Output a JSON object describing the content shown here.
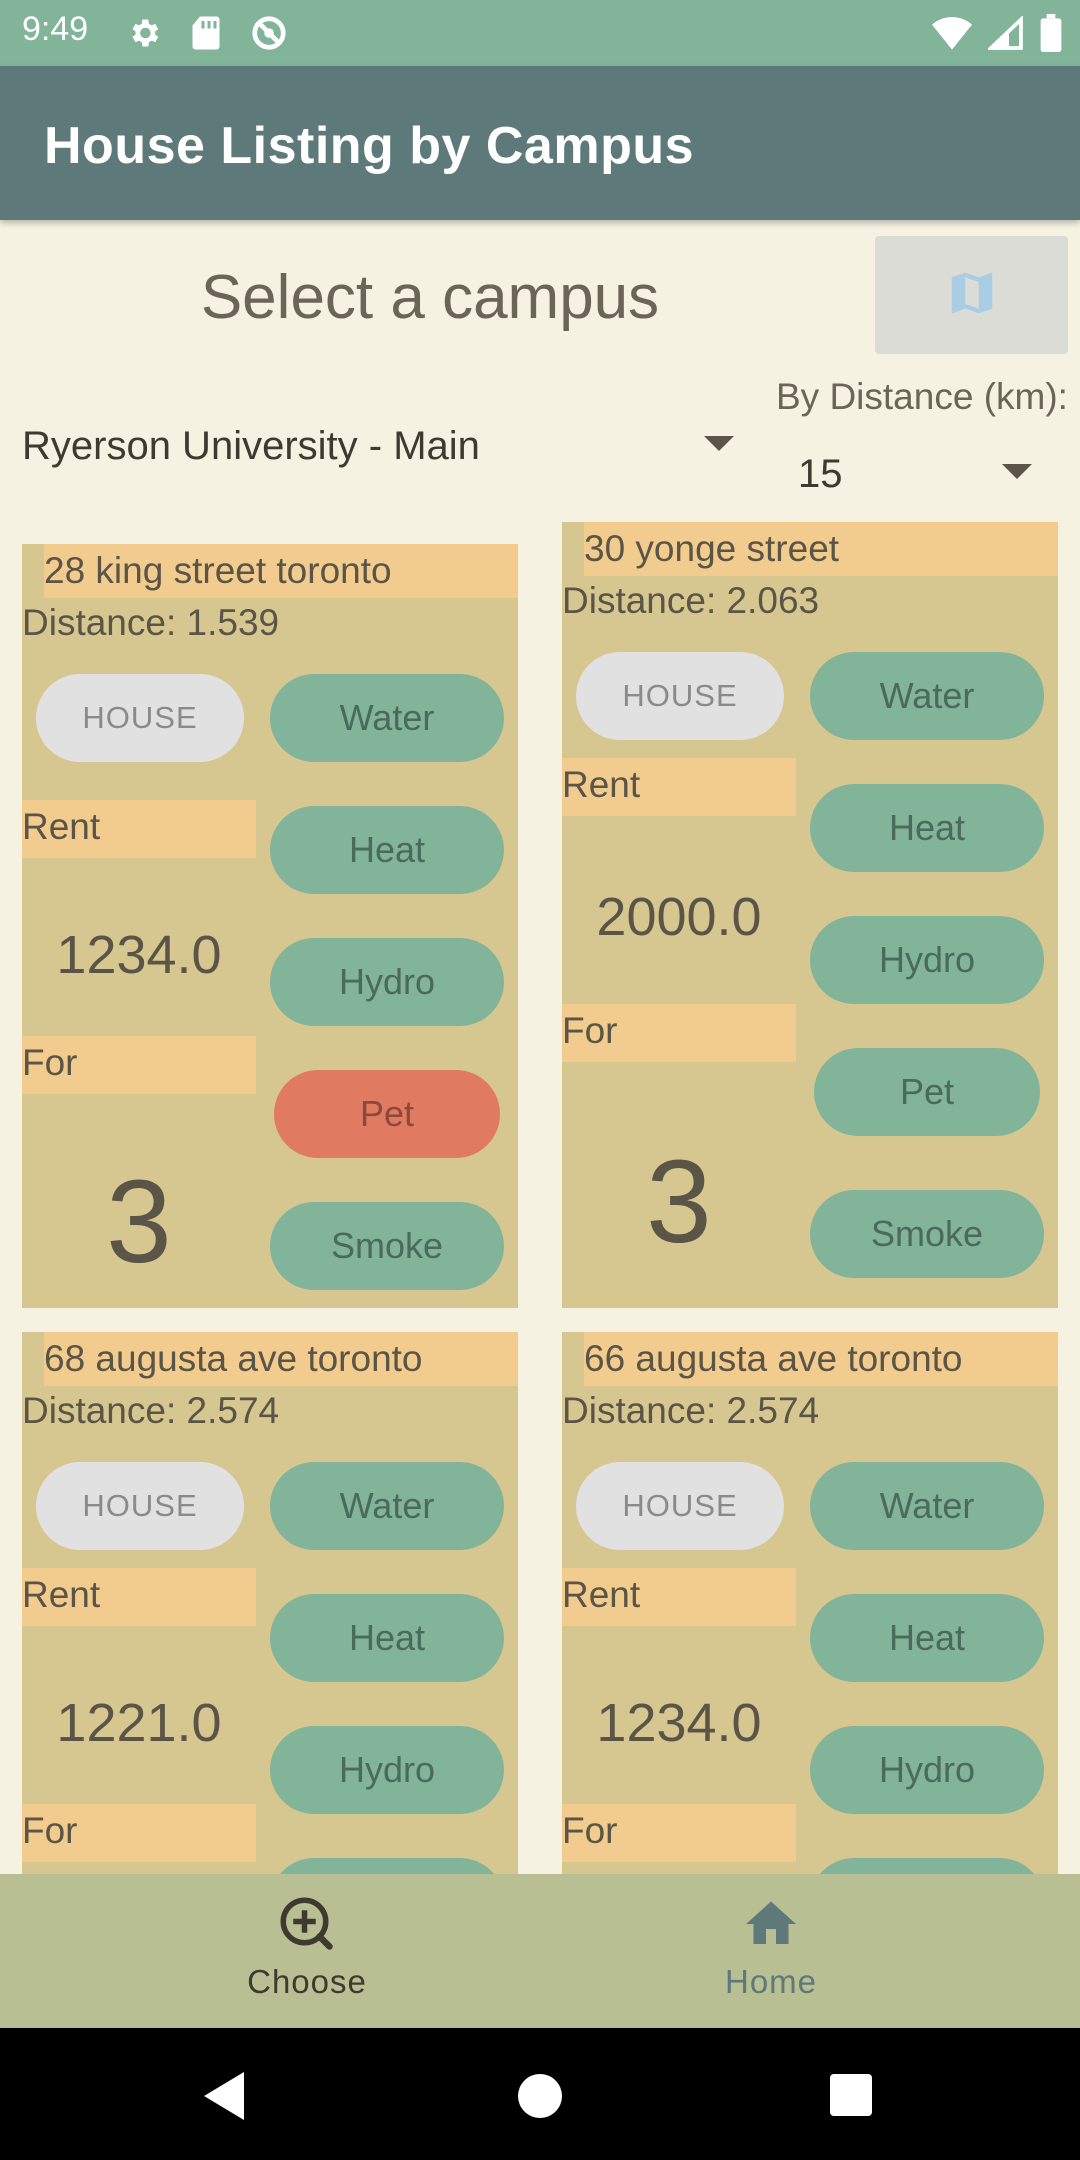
{
  "status_bar": {
    "time": "9:49",
    "left_icons": [
      "gear-icon",
      "sd-card-icon",
      "sync-off-icon"
    ],
    "right_icons": [
      "wifi-icon",
      "signal-icon",
      "battery-icon"
    ]
  },
  "app_bar": {
    "title": "House Listing by Campus"
  },
  "filters": {
    "heading": "Select a campus",
    "map_button_icon": "map-icon",
    "campus_selected": "Ryerson University - Main",
    "distance_label": "By Distance (km):",
    "distance_selected": "15"
  },
  "listings": [
    {
      "address": "28 king street toronto",
      "distance": "Distance: 1.539",
      "type": "HOUSE",
      "rent_label": "Rent",
      "rent": "1234.0",
      "for_label": "For",
      "for_count": "3",
      "utilities": [
        {
          "label": "Water",
          "included": true
        },
        {
          "label": "Heat",
          "included": true
        },
        {
          "label": "Hydro",
          "included": true
        },
        {
          "label": "Pet",
          "included": false
        },
        {
          "label": "Smoke",
          "included": true
        }
      ]
    },
    {
      "address": "30 yonge street",
      "distance": "Distance: 2.063",
      "type": "HOUSE",
      "rent_label": "Rent",
      "rent": "2000.0",
      "for_label": "For",
      "for_count": "3",
      "utilities": [
        {
          "label": "Water",
          "included": true
        },
        {
          "label": "Heat",
          "included": true
        },
        {
          "label": "Hydro",
          "included": true
        },
        {
          "label": "Pet",
          "included": true
        },
        {
          "label": "Smoke",
          "included": true
        }
      ]
    },
    {
      "address": "68 augusta ave toronto",
      "distance": "Distance: 2.574",
      "type": "HOUSE",
      "rent_label": "Rent",
      "rent": "1221.0",
      "for_label": "For",
      "utilities": [
        {
          "label": "Water",
          "included": true
        },
        {
          "label": "Heat",
          "included": true
        },
        {
          "label": "Hydro",
          "included": true
        }
      ]
    },
    {
      "address": "66 augusta ave toronto",
      "distance": "Distance: 2.574",
      "type": "HOUSE",
      "rent_label": "Rent",
      "rent": "1234.0",
      "for_label": "For",
      "utilities": [
        {
          "label": "Water",
          "included": true
        },
        {
          "label": "Heat",
          "included": true
        },
        {
          "label": "Hydro",
          "included": true
        }
      ]
    }
  ],
  "bottom_nav": {
    "items": [
      {
        "label": "Choose",
        "icon": "add-circle-icon"
      },
      {
        "label": "Home",
        "icon": "home-icon"
      }
    ]
  },
  "colors": {
    "status_bar": "#82b49a",
    "app_bar": "#5e797a",
    "card": "#d6c791",
    "label_highlight": "#f2cb8f",
    "utility_included": "#82b49a",
    "utility_excluded": "#e07a60",
    "bottom_nav": "#b8c093"
  }
}
